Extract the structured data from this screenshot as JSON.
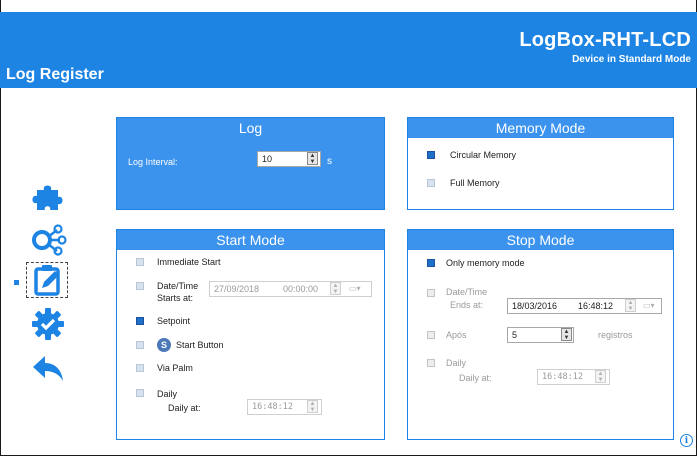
{
  "header": {
    "product": "LogBox-RHT-LCD",
    "mode": "Device in Standard Mode",
    "page_title": "Log Register"
  },
  "colors": {
    "accent": "#1e84e3",
    "panel_fill": "#3b93ee",
    "checked": "#1e6fc8"
  },
  "sidebar": {
    "items": [
      {
        "icon": "puzzle-icon"
      },
      {
        "icon": "share-nodes-icon"
      },
      {
        "icon": "edit-register-icon",
        "selected": true
      },
      {
        "icon": "settings-check-icon"
      },
      {
        "icon": "back-arrow-icon"
      }
    ]
  },
  "log": {
    "title": "Log",
    "interval_label": "Log Interval:",
    "interval_value": "10",
    "unit": "s"
  },
  "memory_mode": {
    "title": "Memory Mode",
    "options": [
      {
        "label": "Circular Memory",
        "checked": true
      },
      {
        "label": "Full Memory",
        "checked": false
      }
    ]
  },
  "start_mode": {
    "title": "Start Mode",
    "immediate_label": "Immediate Start",
    "datetime_label_1": "Date/Time",
    "datetime_label_2": "Starts at:",
    "datetime_date": "27/09/2018",
    "datetime_time": "00:00:00",
    "setpoint_label": "Setpoint",
    "setpoint_checked": true,
    "start_button_badge": "S",
    "start_button_label": "Start Button",
    "via_palm_label": "Via Palm",
    "daily_label": "Daily",
    "daily_at_label": "Daily at:",
    "daily_time": "16:48:12"
  },
  "stop_mode": {
    "title": "Stop Mode",
    "only_memory_label": "Only memory mode",
    "only_memory_checked": true,
    "datetime_label_1": "Date/Time",
    "datetime_label_2": "Ends at:",
    "datetime_date": "18/03/2016",
    "datetime_time": "16:48:12",
    "apos_label": "Após",
    "apos_value": "5",
    "registros_label": "registros",
    "daily_label": "Daily",
    "daily_at_label": "Daily at:",
    "daily_time": "16:48:12"
  },
  "info_glyph": "i"
}
